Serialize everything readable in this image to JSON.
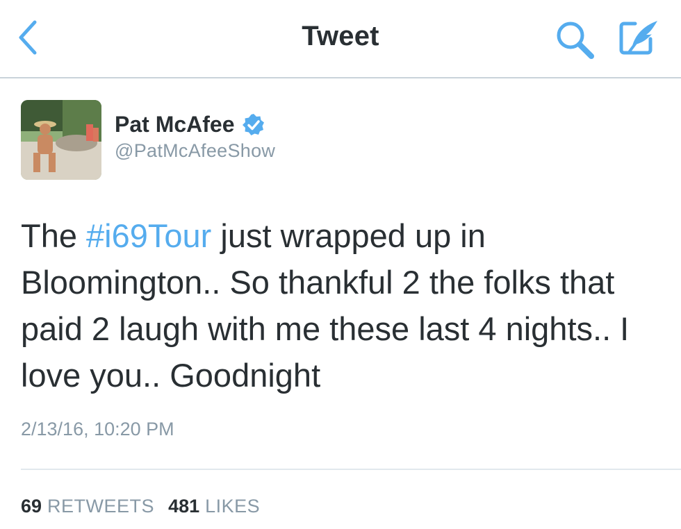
{
  "header": {
    "title": "Tweet",
    "back_icon": "chevron-left-icon",
    "search_icon": "search-icon",
    "compose_icon": "compose-tweet-icon",
    "accent_color": "#55acee"
  },
  "tweet": {
    "author": {
      "display_name": "Pat McAfee",
      "handle": "@PatMcAfeeShow",
      "verified": true,
      "verified_icon": "verified-badge-icon"
    },
    "text": {
      "before_hashtag": "The ",
      "hashtag": "#i69Tour",
      "after_hashtag": " just wrapped up in Bloomington.. So thankful 2 the folks that paid 2 laugh with me these last 4 nights.. I love you.. Goodnight"
    },
    "timestamp": "2/13/16, 10:20 PM",
    "stats": {
      "retweets_count": "69",
      "retweets_label": "RETWEETS",
      "likes_count": "481",
      "likes_label": "LIKES"
    }
  }
}
